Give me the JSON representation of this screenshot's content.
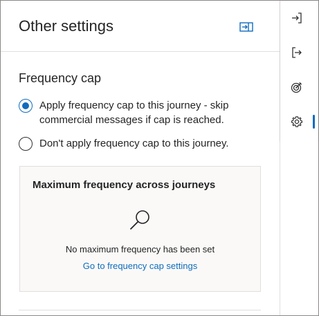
{
  "panel": {
    "title": "Other settings",
    "collapse_icon": "collapse-panel-icon"
  },
  "frequency_cap": {
    "section_title": "Frequency cap",
    "options": [
      {
        "label": "Apply frequency cap to this journey - skip commercial messages if cap is reached.",
        "selected": true
      },
      {
        "label": "Don't apply frequency cap to this journey.",
        "selected": false
      }
    ]
  },
  "card": {
    "title": "Maximum frequency across journeys",
    "icon": "search-icon",
    "message": "No maximum frequency has been set",
    "link": "Go to frequency cap settings"
  },
  "rail": {
    "items": [
      {
        "icon": "sign-in-icon"
      },
      {
        "icon": "sign-out-icon"
      },
      {
        "icon": "target-icon"
      },
      {
        "icon": "gear-icon",
        "active": true
      }
    ]
  },
  "colors": {
    "accent": "#0f6cbd",
    "border": "#e1dfdd",
    "card_bg": "#faf9f8",
    "text": "#242424"
  }
}
